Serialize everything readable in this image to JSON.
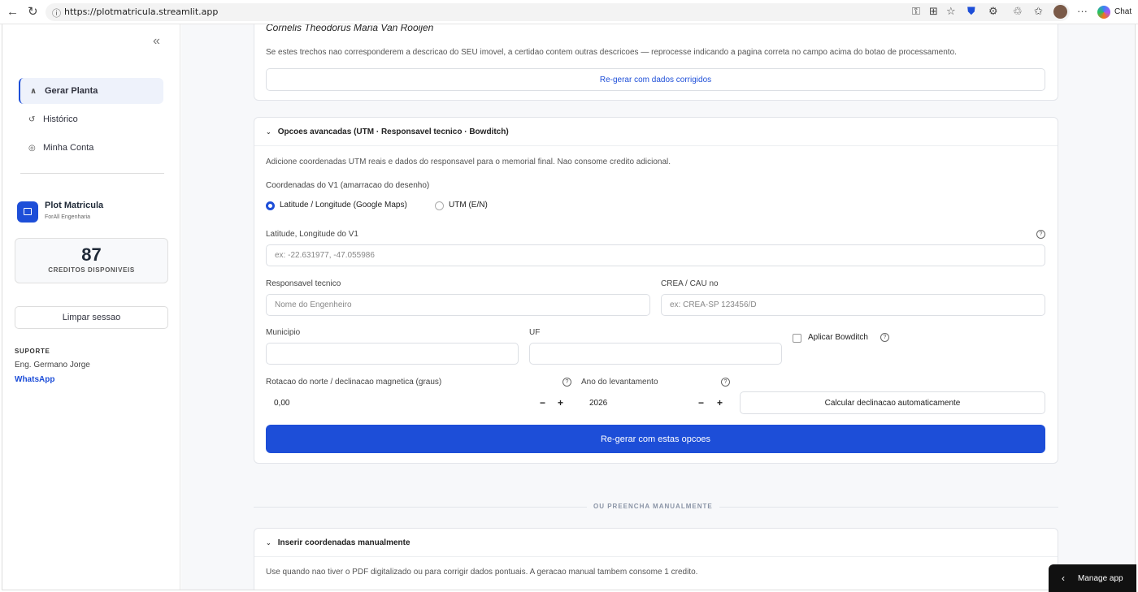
{
  "browser": {
    "url": "https://plotmatricula.streamlit.app",
    "chat_label": "Chat"
  },
  "sidebar": {
    "nav": [
      {
        "label": "Gerar Planta",
        "icon": "compass-icon",
        "glyph": "∧",
        "active": true
      },
      {
        "label": "Histórico",
        "icon": "history-icon",
        "glyph": "↺",
        "active": false
      },
      {
        "label": "Minha Conta",
        "icon": "account-icon",
        "glyph": "◎",
        "active": false
      }
    ],
    "brand": {
      "name": "Plot Matricula",
      "sub": "ForAll Engenharia"
    },
    "credits": {
      "value": "87",
      "label": "CREDITOS DISPONIVEIS"
    },
    "clear_label": "Limpar sessao",
    "support": {
      "heading": "SUPORTE",
      "name": "Eng. Germano Jorge",
      "link": "WhatsApp"
    }
  },
  "top_card": {
    "name": "Cornelis Theodorus Maria Van Rooijen",
    "note": "Se estes trechos nao corresponderem a descricao do SEU imovel, a certidao contem outras descricoes — reprocesse indicando a pagina correta no campo acima do botao de processamento.",
    "button": "Re-gerar com dados corrigidos"
  },
  "advanced": {
    "title": "Opcoes avancadas (UTM · Responsavel tecnico · Bowditch)",
    "intro": "Adicione coordenadas UTM reais e dados do responsavel para o memorial final. Nao consome credito adicional.",
    "coords_label": "Coordenadas do V1 (amarracao do desenho)",
    "radio_options": [
      "Latitude / Longitude (Google Maps)",
      "UTM (E/N)"
    ],
    "latlon_label": "Latitude, Longitude do V1",
    "latlon_placeholder": "ex: -22.631977, -47.055986",
    "resp_label": "Responsavel tecnico",
    "resp_placeholder": "Nome do Engenheiro",
    "crea_label": "CREA / CAU no",
    "crea_placeholder": "ex: CREA-SP 123456/D",
    "municipio_label": "Municipio",
    "uf_label": "UF",
    "bowditch_label": "Aplicar Bowditch",
    "rotation_label": "Rotacao do norte / declinacao magnetica (graus)",
    "rotation_value": "0,00",
    "year_label": "Ano do levantamento",
    "year_value": "2026",
    "calc_button": "Calcular declinacao automaticamente",
    "regen_button": "Re-gerar com estas opcoes",
    "minus": "−",
    "plus": "+"
  },
  "divider_label": "OU PREENCHA MANUALMENTE",
  "manual": {
    "title": "Inserir coordenadas manualmente",
    "note": "Use quando nao tiver o PDF digitalizado ou para corrigir dados pontuais. A geracao manual tambem consome 1 credito."
  },
  "manage_app": "Manage app",
  "colors": {
    "accent": "#1d4ed8",
    "background": "#f7f8fa"
  }
}
